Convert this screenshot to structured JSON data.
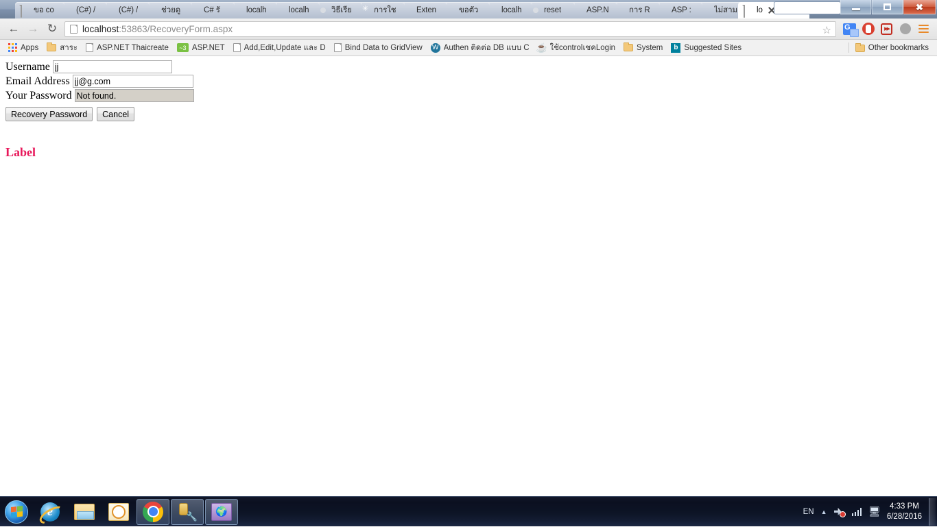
{
  "window": {
    "controls": {
      "minimize": "Minimize",
      "maximize": "Restore",
      "close": "Close"
    },
    "search_value": ""
  },
  "tabs": [
    {
      "title": "ขอ co",
      "favicon": "page-icon",
      "active": false
    },
    {
      "title": "(C#) /",
      "favicon": "page-icon",
      "active": false
    },
    {
      "title": "(C#) /",
      "favicon": "page-icon",
      "active": false
    },
    {
      "title": "ช่วยดู",
      "favicon": "page-icon",
      "active": false
    },
    {
      "title": "C# รั",
      "favicon": "page-icon",
      "active": false
    },
    {
      "title": "localh",
      "favicon": "page-icon",
      "active": false
    },
    {
      "title": "localh",
      "favicon": "page-icon",
      "active": false
    },
    {
      "title": "วิธีเรีย",
      "favicon": "google-icon",
      "active": false
    },
    {
      "title": "การใช",
      "favicon": "snowflake-icon",
      "active": false
    },
    {
      "title": "Exten",
      "favicon": "page-icon",
      "active": false
    },
    {
      "title": "ขอตัว",
      "favicon": "page-icon",
      "active": false
    },
    {
      "title": "localh",
      "favicon": "page-icon",
      "active": false
    },
    {
      "title": "reset",
      "favicon": "google-icon",
      "active": false
    },
    {
      "title": "ASP.N",
      "favicon": "page-icon",
      "active": false
    },
    {
      "title": "การ R",
      "favicon": "page-icon",
      "active": false
    },
    {
      "title": "ASP :",
      "favicon": "page-icon",
      "active": false
    },
    {
      "title": "ไม่สาม",
      "favicon": "page-icon",
      "active": false
    },
    {
      "title": "lo",
      "favicon": "page-icon",
      "active": true
    }
  ],
  "toolbar": {
    "back": "Back",
    "forward": "Forward",
    "reload": "Reload",
    "url_host": "localhost",
    "url_rest": ":53863/RecoveryForm.aspx",
    "url_full": "localhost:53863/RecoveryForm.aspx",
    "bookmark_star": "Bookmark this page",
    "extensions": [
      {
        "name": "google-translate-icon",
        "label": "Google Translate"
      },
      {
        "name": "adblock-icon",
        "label": "AdBlock"
      },
      {
        "name": "fast-forward-icon",
        "label": "Fast Forward"
      }
    ],
    "profile": "Profile",
    "menu": "Customize and control Google Chrome"
  },
  "bookmarks": {
    "apps_label": "Apps",
    "items": [
      {
        "label": "สาระ",
        "icon": "folder-icon"
      },
      {
        "label": "ASP.NET Thaicreate",
        "icon": "page-icon"
      },
      {
        "label": "ASP.NET",
        "icon": "aspnet-icon"
      },
      {
        "label": "Add,Edit,Update และ D",
        "icon": "page-icon"
      },
      {
        "label": "Bind Data to GridView",
        "icon": "page-icon"
      },
      {
        "label": "Authen ติดต่อ DB แบบ C",
        "icon": "wordpress-icon"
      },
      {
        "label": "ใช้controlเชคLogin",
        "icon": "java-icon"
      },
      {
        "label": "System",
        "icon": "folder-icon"
      },
      {
        "label": "Suggested Sites",
        "icon": "bing-icon"
      }
    ],
    "other_label": "Other bookmarks",
    "other_icon": "folder-icon"
  },
  "page": {
    "fields": [
      {
        "label": "Username",
        "value": "jj",
        "placeholder": "",
        "readonly": false
      },
      {
        "label": "Email Address",
        "value": "jj@g.com",
        "placeholder": "",
        "readonly": false
      },
      {
        "label": "Your Password",
        "value": "Not found.",
        "placeholder": "",
        "readonly": true
      }
    ],
    "buttons": {
      "submit": "Recovery Password",
      "cancel": "Cancel"
    },
    "status_label": "Label",
    "status_color": "#e8185b"
  },
  "taskbar": {
    "start": "Start",
    "apps": [
      {
        "name": "internet-explorer",
        "label": "Internet Explorer",
        "running": false,
        "glyph": "e"
      },
      {
        "name": "windows-explorer",
        "label": "Windows Explorer",
        "running": false
      },
      {
        "name": "outlook",
        "label": "Microsoft Outlook",
        "running": false
      },
      {
        "name": "google-chrome",
        "label": "Google Chrome",
        "running": true
      },
      {
        "name": "sql-server-tools",
        "label": "SQL Server Tools",
        "running": true
      },
      {
        "name": "iis-manager",
        "label": "IIS Manager",
        "running": true
      }
    ],
    "tray": {
      "language": "EN",
      "show_hidden": "Show hidden icons",
      "network": "network-error-icon",
      "signal": "signal-bars-icon",
      "device": "device-icon",
      "time": "4:33 PM",
      "date": "6/28/2016"
    }
  }
}
